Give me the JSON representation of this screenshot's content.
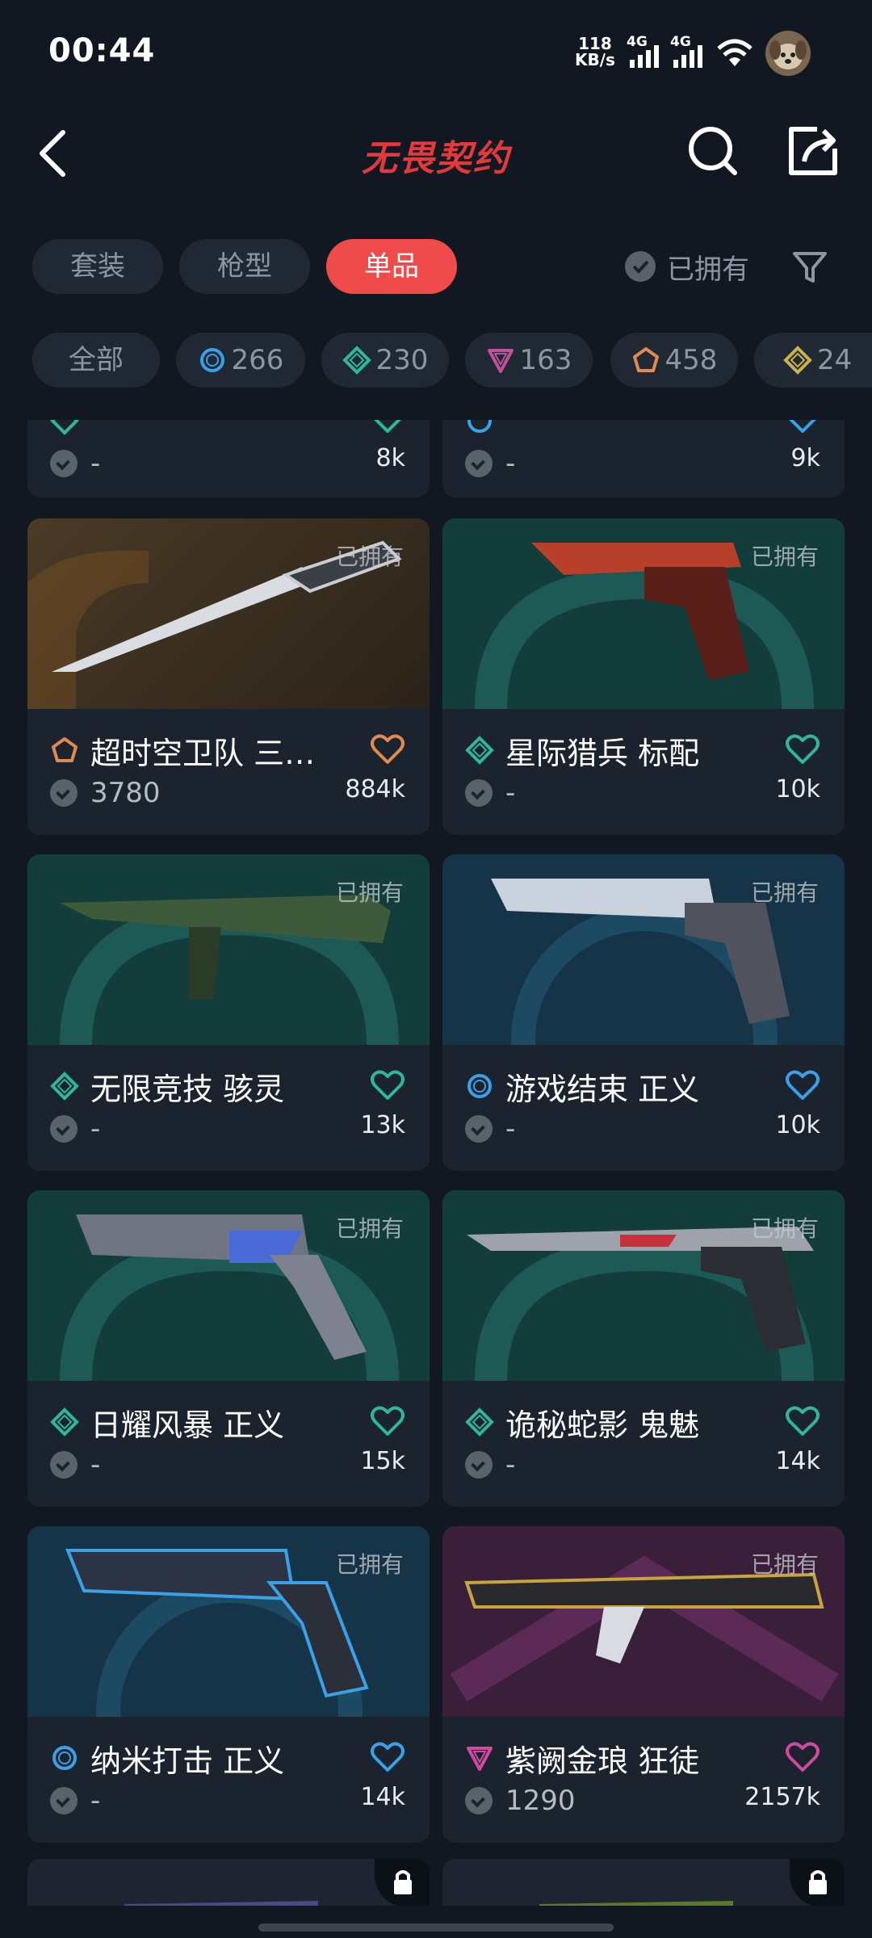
{
  "status_bar": {
    "time": "00:44",
    "net_speed_value": "118",
    "net_speed_unit": "KB/s",
    "signal1_label": "4G",
    "signal2_label": "4G"
  },
  "header": {
    "title": "无畏契约"
  },
  "tabs": [
    {
      "label": "套装",
      "active": false
    },
    {
      "label": "枪型",
      "active": false
    },
    {
      "label": "单品",
      "active": true
    }
  ],
  "owned_toggle": {
    "label": "已拥有"
  },
  "chips": [
    {
      "label": "全部",
      "icon": "",
      "color": ""
    },
    {
      "label": "266",
      "icon": "circle-tier-icon",
      "color": "#3aa0e8"
    },
    {
      "label": "230",
      "icon": "diamond-tier-icon",
      "color": "#2fb79a"
    },
    {
      "label": "163",
      "icon": "triangle-tier-icon",
      "color": "#c0509a"
    },
    {
      "label": "458",
      "icon": "pentagon-tier-icon",
      "color": "#e08a50"
    },
    {
      "label": "24",
      "icon": "diamond-tier-icon",
      "color": "#c9b24a"
    }
  ],
  "cards": [
    {
      "name": "",
      "owned": "",
      "price": "-",
      "likes": "8k",
      "tier_color": "#2fb79a",
      "heart_color": "#2fb79a",
      "bg": "#1a232e"
    },
    {
      "name": "",
      "owned": "",
      "price": "-",
      "likes": "9k",
      "tier_color": "#3aa0e8",
      "heart_color": "#3aa0e8",
      "bg": "#1a232e"
    },
    {
      "name": "超时空卫队 三…",
      "owned": "已拥有",
      "price": "3780",
      "likes": "884k",
      "tier_color": "#e08a50",
      "heart_color": "#e08a50",
      "bg": "#3a2e22"
    },
    {
      "name": "星际猎兵 标配",
      "owned": "已拥有",
      "price": "-",
      "likes": "10k",
      "tier_color": "#2fb79a",
      "heart_color": "#2fb79a",
      "bg": "#123d3b"
    },
    {
      "name": "无限竞技 骇灵",
      "owned": "已拥有",
      "price": "-",
      "likes": "13k",
      "tier_color": "#2fb79a",
      "heart_color": "#2fb79a",
      "bg": "#123d3b"
    },
    {
      "name": "游戏结束 正义",
      "owned": "已拥有",
      "price": "-",
      "likes": "10k",
      "tier_color": "#3aa0e8",
      "heart_color": "#3aa0e8",
      "bg": "#163447"
    },
    {
      "name": "日耀风暴 正义",
      "owned": "已拥有",
      "price": "-",
      "likes": "15k",
      "tier_color": "#2fb79a",
      "heart_color": "#2fb79a",
      "bg": "#123d3b"
    },
    {
      "name": "诡秘蛇影 鬼魅",
      "owned": "已拥有",
      "price": "-",
      "likes": "14k",
      "tier_color": "#2fb79a",
      "heart_color": "#2fb79a",
      "bg": "#123d3b"
    },
    {
      "name": "纳米打击 正义",
      "owned": "已拥有",
      "price": "-",
      "likes": "14k",
      "tier_color": "#3aa0e8",
      "heart_color": "#3aa0e8",
      "bg": "#163447"
    },
    {
      "name": "紫阙金琅 狂徒",
      "owned": "已拥有",
      "price": "1290",
      "likes": "2157k",
      "tier_color": "#d04aa0",
      "heart_color": "#d04aa0",
      "bg": "#3a1f3b"
    }
  ]
}
